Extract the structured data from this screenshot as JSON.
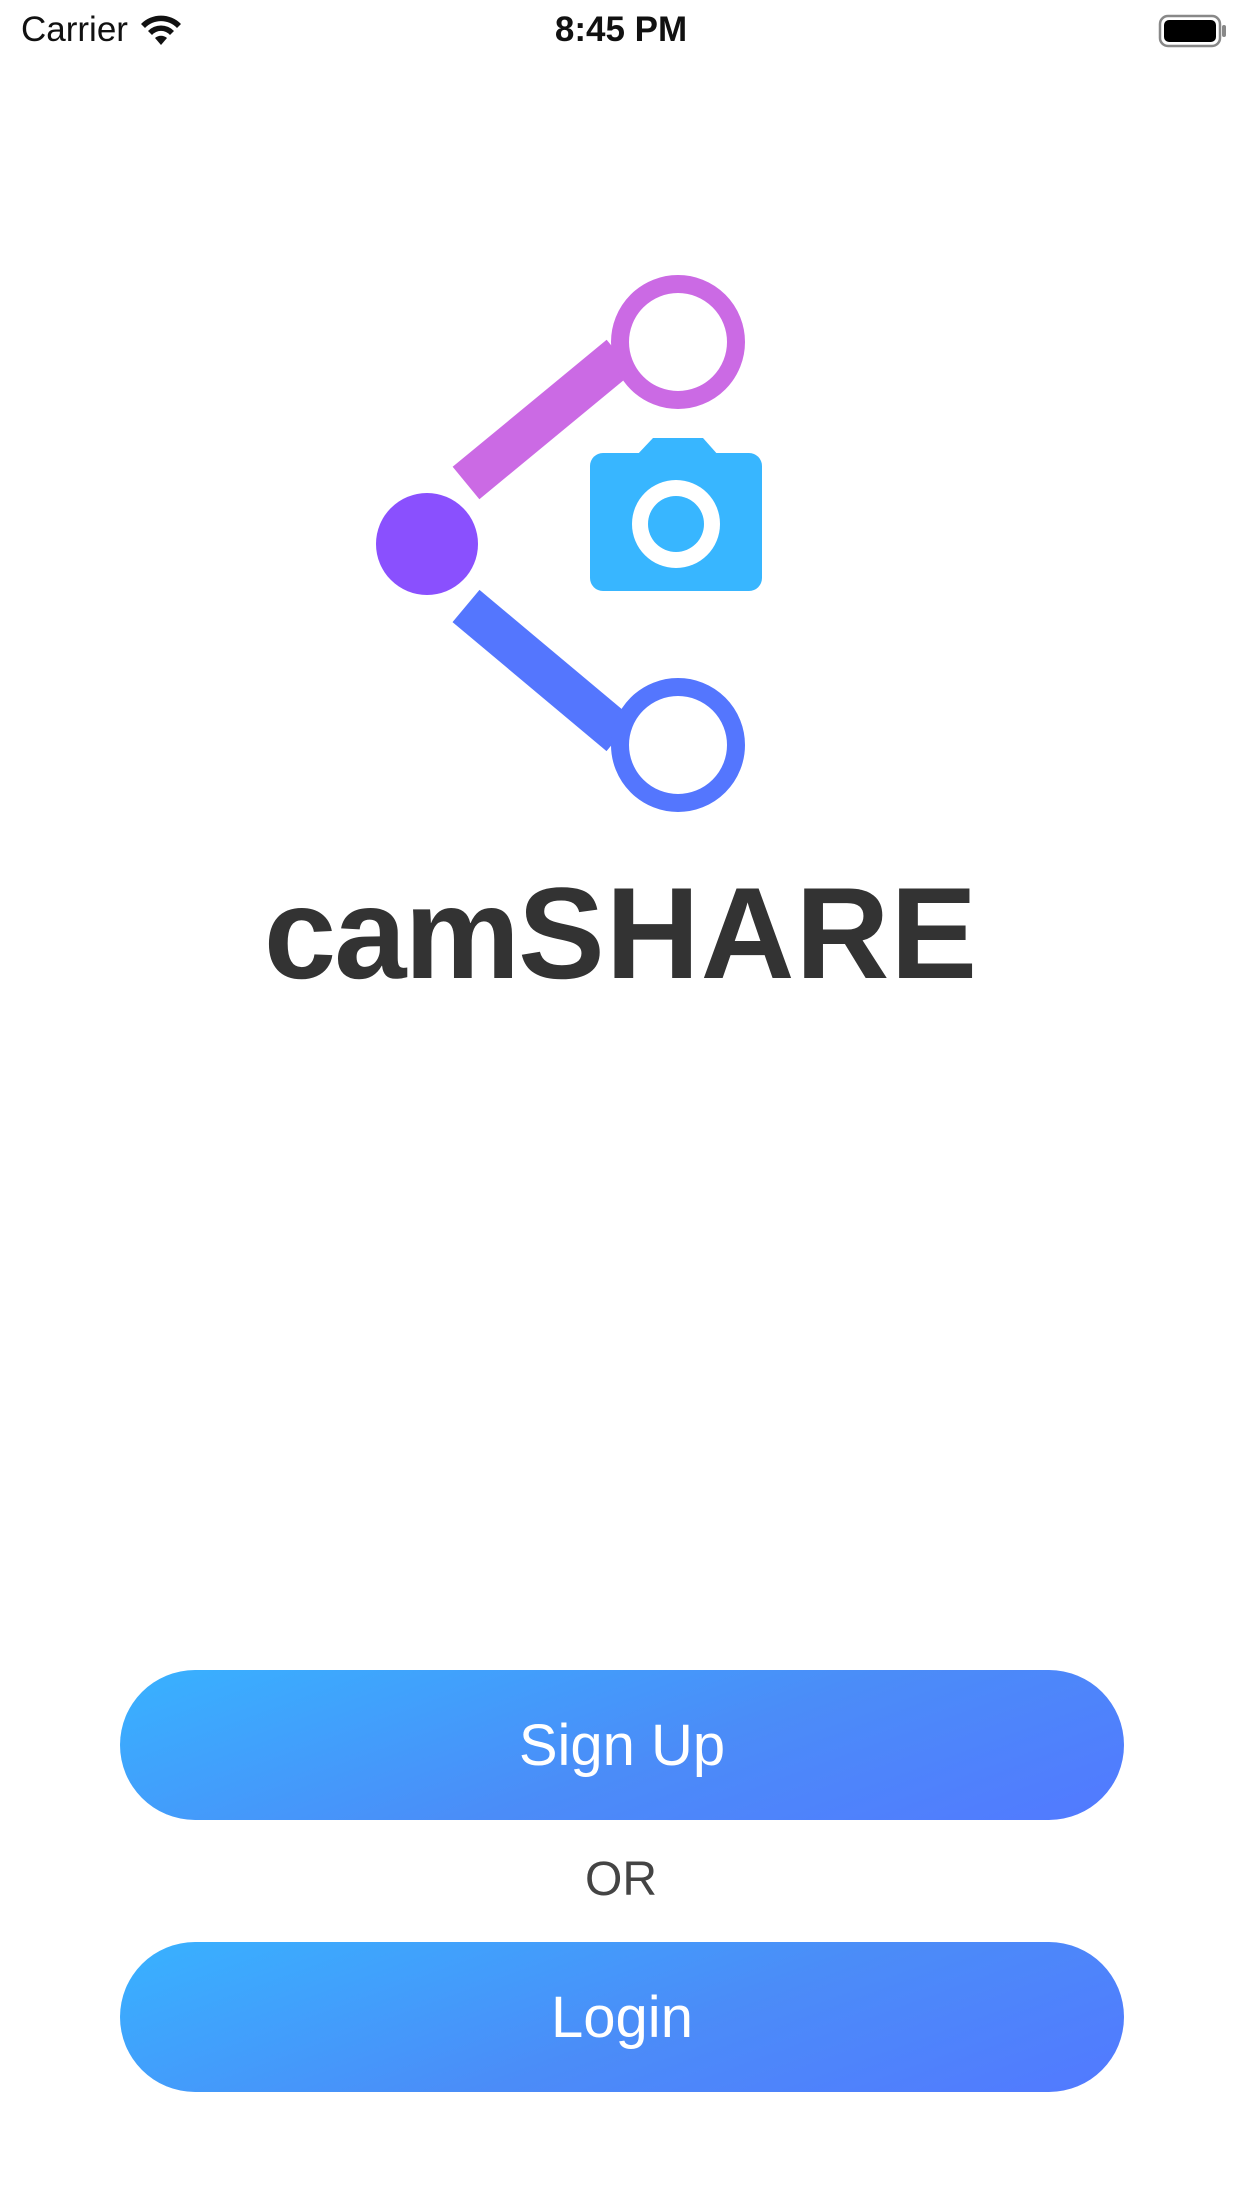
{
  "status_bar": {
    "carrier": "Carrier",
    "time": "8:45 PM",
    "wifi_icon": "wifi-icon",
    "battery_icon": "battery-full-icon"
  },
  "logo": {
    "icon": "share-camera-logo",
    "wordmark_part1": "cam",
    "wordmark_part2": "SHARE",
    "colors": {
      "purple_node": "#8a50fe",
      "pink_branch": "#cb6ae4",
      "blue_branch": "#5476fe",
      "camera": "#38b6ff",
      "text": "#333333"
    }
  },
  "actions": {
    "signup_label": "Sign Up",
    "or_label": "OR",
    "login_label": "Login",
    "button_gradient": [
      "#38b2ff",
      "#5279ff"
    ]
  }
}
